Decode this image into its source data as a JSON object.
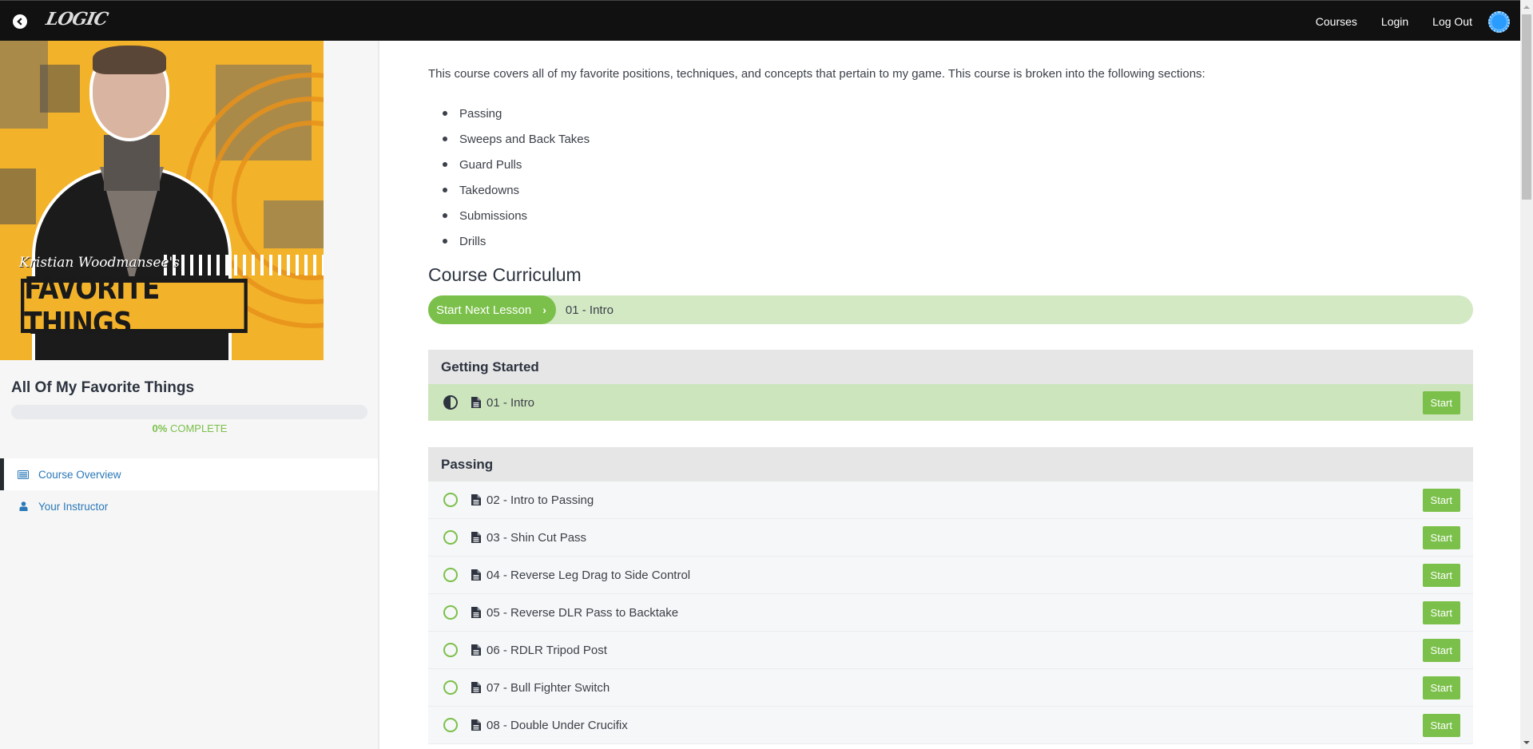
{
  "header": {
    "logo_text": "LOGIC",
    "nav": [
      "Courses",
      "Login",
      "Log Out"
    ]
  },
  "sidebar": {
    "image": {
      "script_text": "Kristian Woodmansee's",
      "title_text": "FAVORITE THINGS"
    },
    "course_title": "All Of My Favorite Things",
    "progress": {
      "percent": 0,
      "percent_label": "0%",
      "suffix": " COMPLETE"
    },
    "nav": [
      {
        "label": "Course Overview",
        "icon": "list-icon",
        "active": true
      },
      {
        "label": "Your Instructor",
        "icon": "user-icon",
        "active": false
      }
    ]
  },
  "main": {
    "intro": "This course covers all of my favorite positions, techniques, and concepts that pertain to my game. This course is broken into the following sections:",
    "sections_list": [
      "Passing",
      "Sweeps and Back Takes",
      "Guard Pulls",
      "Takedowns",
      "Submissions",
      "Drills"
    ],
    "curriculum_title": "Course Curriculum",
    "next_lesson": {
      "button_label": "Start Next Lesson",
      "chevron": "›",
      "lesson_name": "01 - Intro"
    },
    "start_label": "Start",
    "sections": [
      {
        "title": "Getting Started",
        "lessons": [
          {
            "name": "01 - Intro",
            "status": "in-progress"
          }
        ]
      },
      {
        "title": "Passing",
        "lessons": [
          {
            "name": "02 - Intro to Passing",
            "status": "not-started"
          },
          {
            "name": "03 - Shin Cut Pass",
            "status": "not-started"
          },
          {
            "name": "04 - Reverse Leg Drag to Side Control",
            "status": "not-started"
          },
          {
            "name": "05 - Reverse DLR Pass to Backtake",
            "status": "not-started"
          },
          {
            "name": "06 - RDLR Tripod Post",
            "status": "not-started"
          },
          {
            "name": "07 - Bull Fighter Switch",
            "status": "not-started"
          },
          {
            "name": "08 - Double Under Crucifix",
            "status": "not-started"
          }
        ]
      }
    ]
  },
  "colors": {
    "accent_green": "#7bc04a",
    "light_green": "#d2e9c4",
    "link_blue": "#2a78b8",
    "header_bg": "#111111"
  }
}
